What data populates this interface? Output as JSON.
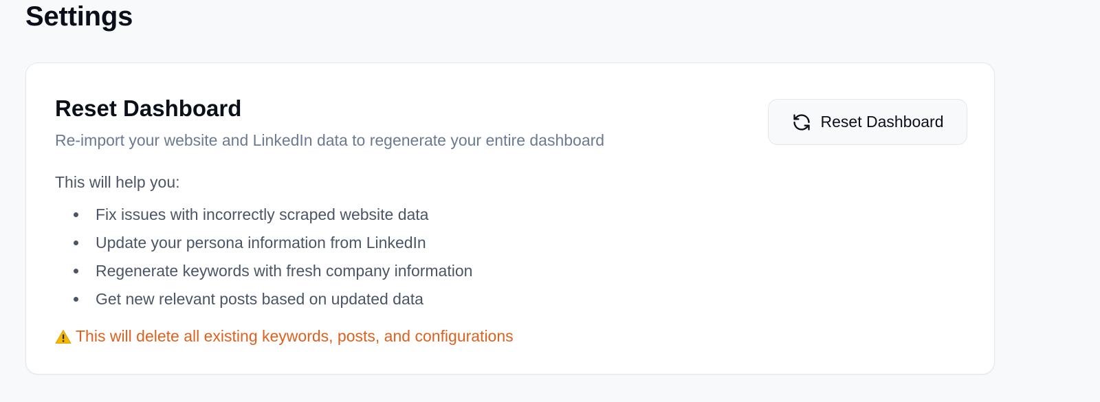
{
  "page": {
    "title": "Settings"
  },
  "card": {
    "title": "Reset Dashboard",
    "description": "Re-import your website and LinkedIn data to regenerate your entire dashboard",
    "help_intro": "This will help you:",
    "help_items": [
      "Fix issues with incorrectly scraped website data",
      "Update your persona information from LinkedIn",
      "Regenerate keywords with fresh company information",
      "Get new relevant posts based on updated data"
    ],
    "warning": "This will delete all existing keywords, posts, and configurations",
    "warning_icon": "warning-triangle-icon",
    "button_label": "Reset Dashboard",
    "button_icon": "refresh-icon"
  },
  "colors": {
    "background": "#f8f9fb",
    "card": "#ffffff",
    "description": "#6b7a90",
    "body_text": "#4b5565",
    "warning": "#e0601e",
    "warning_icon": "#f5b800"
  }
}
